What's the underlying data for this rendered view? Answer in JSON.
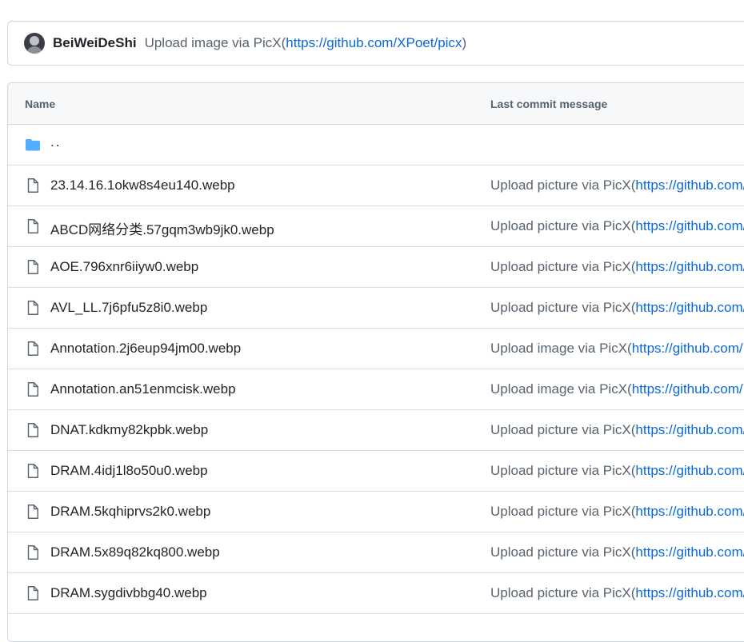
{
  "commit": {
    "author": "BeiWeiDeShi",
    "message_prefix": "Upload image via PicX(",
    "message_link": "https://github.com/XPoet/picx",
    "message_suffix": ")"
  },
  "table": {
    "col_name": "Name",
    "col_message": "Last commit message",
    "parent_label": "..",
    "rows": [
      {
        "name": "23.14.16.1okw8s4eu140.webp",
        "msg_prefix": "Upload picture via PicX(",
        "msg_link": "https://github.com/"
      },
      {
        "name": "ABCD网络分类.57gqm3wb9jk0.webp",
        "msg_prefix": "Upload picture via PicX(",
        "msg_link": "https://github.com/"
      },
      {
        "name": "AOE.796xnr6iiyw0.webp",
        "msg_prefix": "Upload picture via PicX(",
        "msg_link": "https://github.com/"
      },
      {
        "name": "AVL_LL.7j6pfu5z8i0.webp",
        "msg_prefix": "Upload picture via PicX(",
        "msg_link": "https://github.com/"
      },
      {
        "name": "Annotation.2j6eup94jm00.webp",
        "msg_prefix": "Upload image via PicX(",
        "msg_link": "https://github.com/"
      },
      {
        "name": "Annotation.an51enmcisk.webp",
        "msg_prefix": "Upload image via PicX(",
        "msg_link": "https://github.com/"
      },
      {
        "name": "DNAT.kdkmy82kpbk.webp",
        "msg_prefix": "Upload picture via PicX(",
        "msg_link": "https://github.com/"
      },
      {
        "name": "DRAM.4idj1l8o50u0.webp",
        "msg_prefix": "Upload picture via PicX(",
        "msg_link": "https://github.com/"
      },
      {
        "name": "DRAM.5kqhiprvs2k0.webp",
        "msg_prefix": "Upload picture via PicX(",
        "msg_link": "https://github.com/"
      },
      {
        "name": "DRAM.5x89q82kq800.webp",
        "msg_prefix": "Upload picture via PicX(",
        "msg_link": "https://github.com/"
      },
      {
        "name": "DRAM.sygdivbbg40.webp",
        "msg_prefix": "Upload picture via PicX(",
        "msg_link": "https://github.com/"
      }
    ]
  },
  "icons": {
    "folder": "folder-icon",
    "file": "file-icon"
  },
  "colors": {
    "link": "#0969da",
    "folder": "#54aeff",
    "muted": "#59636e",
    "border": "#d0d7de"
  }
}
